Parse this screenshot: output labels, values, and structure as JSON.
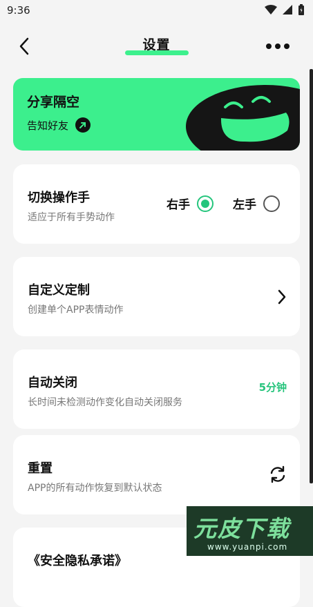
{
  "status_bar": {
    "time": "9:36"
  },
  "header": {
    "title": "设置"
  },
  "share_card": {
    "title": "分享隔空",
    "subtitle": "告知好友"
  },
  "settings": {
    "hand": {
      "title": "切换操作手",
      "desc": "适应于所有手势动作",
      "right_label": "右手",
      "left_label": "左手",
      "selected": "右手"
    },
    "custom": {
      "title": "自定义定制",
      "desc": "创建单个APP表情动作"
    },
    "auto_close": {
      "title": "自动关闭",
      "desc": "长时间未检测动作变化自动关闭服务",
      "value": "5分钟"
    },
    "reset": {
      "title": "重置",
      "desc": "APP的所有动作恢复到默认状态"
    },
    "privacy": {
      "title": "《安全隐私承诺》"
    }
  },
  "watermark": {
    "brand": "元皮下载",
    "url": "www.yuanpi.com"
  },
  "colors": {
    "accent": "#3cef8d",
    "accent_dark": "#24c57c",
    "background": "#f4f4f4"
  }
}
